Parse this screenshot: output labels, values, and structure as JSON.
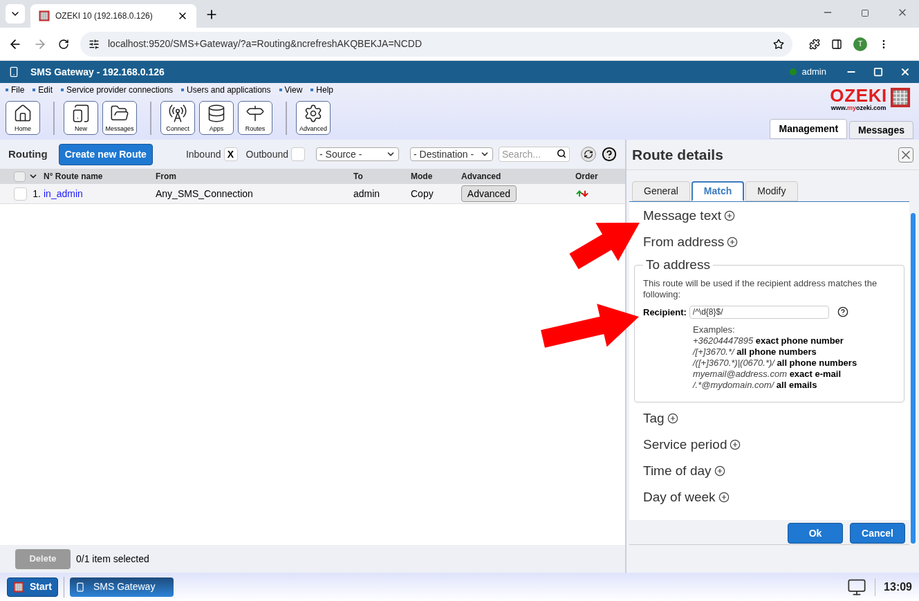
{
  "browser": {
    "tab_title": "OZEKI 10 (192.168.0.126)",
    "url": "localhost:9520/SMS+Gateway/?a=Routing&ncrefreshAKQBEKJA=NCDD",
    "avatar": "T"
  },
  "app": {
    "title": "SMS Gateway - 192.168.0.126",
    "user": "admin",
    "online": true
  },
  "menu": [
    "File",
    "Edit",
    "Service provider connections",
    "Users and applications",
    "View",
    "Help"
  ],
  "toolbar": [
    {
      "label": "Home",
      "group_start": false
    },
    {
      "label": "New",
      "group_start": true
    },
    {
      "label": "Messages",
      "group_start": false
    },
    {
      "label": "Connect",
      "group_start": true
    },
    {
      "label": "Apps",
      "group_start": false
    },
    {
      "label": "Routes",
      "group_start": false
    },
    {
      "label": "Advanced",
      "group_start": true
    }
  ],
  "logo": {
    "name": "OZEKI",
    "url_start": "www.",
    "url_mark": "my",
    "url_end": "ozeki.com"
  },
  "view_tabs": [
    {
      "label": "Management",
      "selected": true
    },
    {
      "label": "Messages",
      "selected": false
    }
  ],
  "routing": {
    "title": "Routing",
    "create_button": "Create new Route",
    "check_glyph": "X",
    "all_selected": false,
    "filters": [
      {
        "label": "Inbound",
        "checked": true
      },
      {
        "label": "Outbound",
        "checked": false
      }
    ],
    "source": "- Source -",
    "destination": "- Destination -",
    "search": {
      "placeholder": "Search..."
    },
    "columns": [
      "N° Route name",
      "From",
      "To",
      "Mode",
      "Advanced",
      "Order"
    ],
    "rows": [
      {
        "number": "1.",
        "name": "in_admin",
        "from": "Any_SMS_Connection",
        "to": "admin",
        "mode": "Copy",
        "advanced": "Advanced",
        "selected": false
      }
    ],
    "delete_button": {
      "label": "Delete",
      "disabled": true
    },
    "status": "0/1 item selected"
  },
  "details": {
    "title": "Route details",
    "tabs": [
      {
        "label": "General",
        "selected": false
      },
      {
        "label": "Match",
        "selected": true
      },
      {
        "label": "Modify",
        "selected": false
      }
    ],
    "sections": [
      {
        "kind": "collapsed",
        "title": "Message text"
      },
      {
        "kind": "collapsed",
        "title": "From address"
      },
      {
        "kind": "expanded",
        "title": "To address",
        "description": "This route will be used if the recipient address matches the following:",
        "field_label": "Recipient:",
        "field_value": "/^\\d{8}$/",
        "examples_title": "Examples:",
        "examples": [
          {
            "pattern": "+36204447895",
            "meaning": "exact phone number"
          },
          {
            "pattern": "/[+]3670.*/",
            "meaning": "all phone numbers"
          },
          {
            "pattern": "/([+]3670.*)|(0670.*)/",
            "meaning": "all phone numbers"
          },
          {
            "pattern": "myemail@address.com",
            "meaning": "exact e-mail"
          },
          {
            "pattern": "/.*@mydomain.com/",
            "meaning": "all emails"
          }
        ]
      },
      {
        "kind": "collapsed",
        "title": "Tag"
      },
      {
        "kind": "collapsed",
        "title": "Service period"
      },
      {
        "kind": "collapsed",
        "title": "Time of day"
      },
      {
        "kind": "collapsed",
        "title": "Day of week"
      }
    ],
    "buttons": [
      "Ok",
      "Cancel"
    ]
  },
  "taskbar": {
    "start": "Start",
    "apps": [
      {
        "label": "SMS Gateway",
        "selected": true
      }
    ],
    "time": "13:09"
  }
}
